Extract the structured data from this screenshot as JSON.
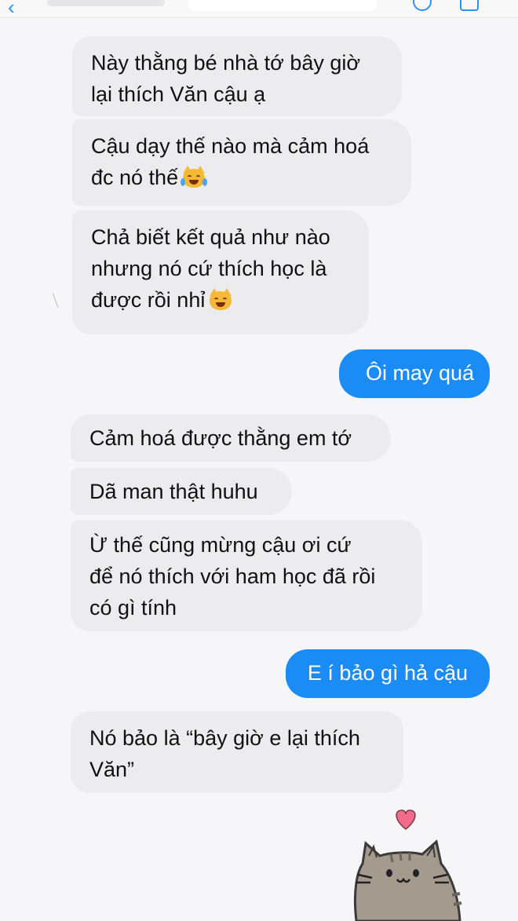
{
  "conversation": {
    "messages": [
      {
        "direction": "incoming",
        "lines": [
          "Này thằng bé nhà tớ bây giờ",
          "lại thích Văn cậu ạ"
        ]
      },
      {
        "direction": "incoming",
        "lines": [
          "Cậu dạy thế nào mà cảm hoá",
          "đc nó thế"
        ],
        "emoji": "cat-tears-of-joy-icon"
      },
      {
        "direction": "incoming",
        "lines": [
          "Chả biết kết quả như nào",
          "nhưng nó cứ thích học là",
          "được rồi nhỉ"
        ],
        "emoji": "grinning-cat-icon"
      },
      {
        "direction": "outgoing",
        "lines": [
          "Ôi may quá"
        ]
      },
      {
        "direction": "incoming",
        "lines": [
          "Cảm hoá được thằng em tớ"
        ]
      },
      {
        "direction": "incoming",
        "lines": [
          "Dã man thật huhu"
        ]
      },
      {
        "direction": "incoming",
        "lines": [
          "Ừ thế cũng mừng cậu ơi cứ",
          "để nó thích với ham học đã rồi",
          "có gì tính"
        ]
      },
      {
        "direction": "outgoing",
        "lines": [
          "E í bảo gì hả cậu"
        ]
      },
      {
        "direction": "incoming",
        "lines": [
          "Nó bảo là “bây giờ e lại thích",
          "Văn”"
        ]
      }
    ]
  },
  "sticker": {
    "name": "pusheen-cat-heart-sticker"
  },
  "colors": {
    "outgoing_bubble": "#1b8cf6",
    "incoming_bubble": "#ececee",
    "heart": "#f06c8a"
  }
}
